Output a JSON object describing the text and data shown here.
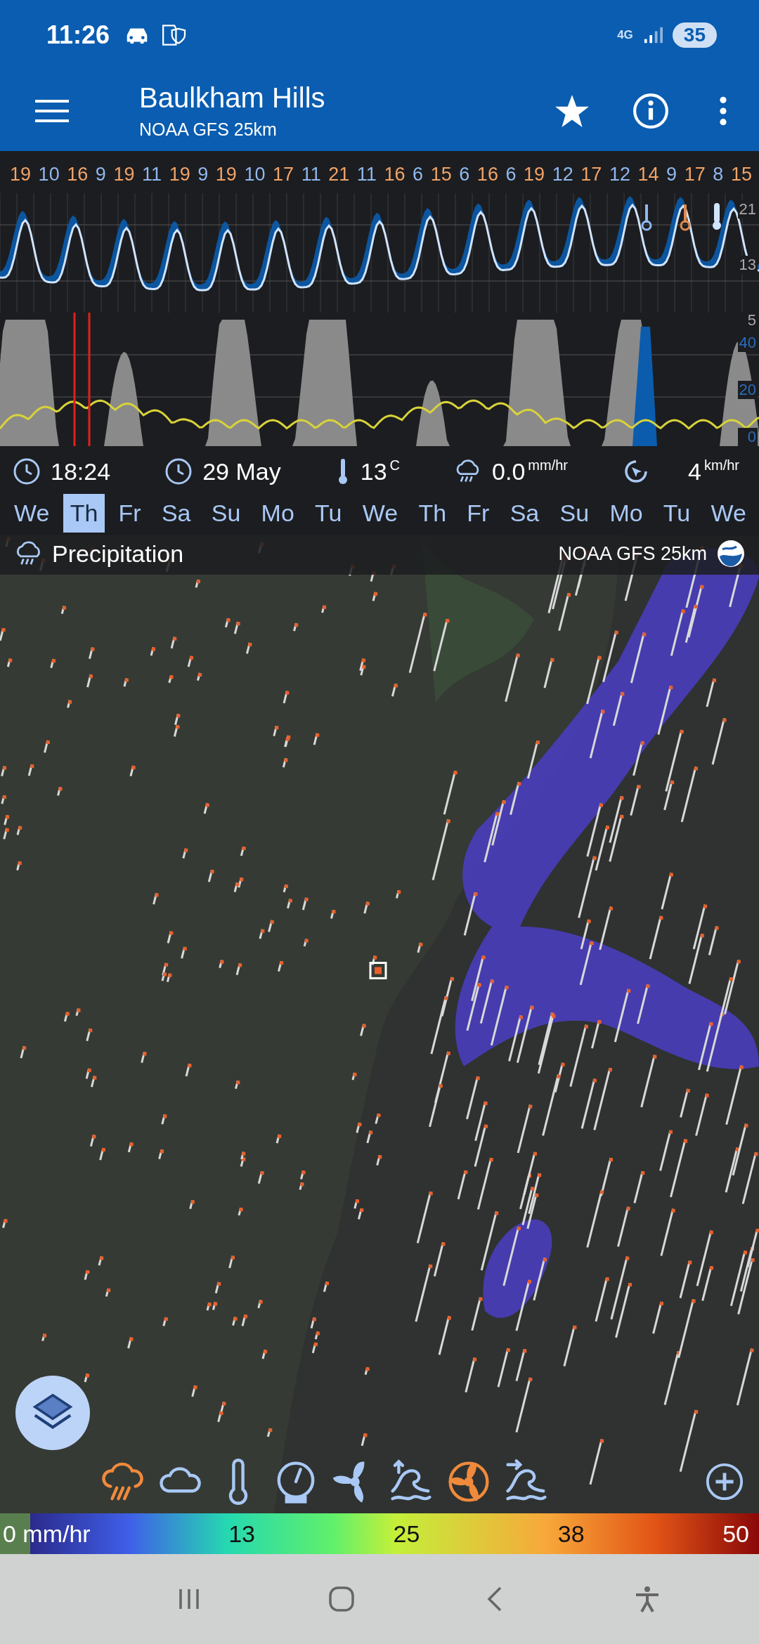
{
  "status_bar": {
    "time": "11:26",
    "network": "4G",
    "battery": "35"
  },
  "app_bar": {
    "title": "Baulkham Hills",
    "subtitle": "NOAA GFS 25km"
  },
  "forecast": {
    "daily_temps": [
      {
        "value": "19",
        "kind": "high"
      },
      {
        "value": "10",
        "kind": "low"
      },
      {
        "value": "16",
        "kind": "high"
      },
      {
        "value": "9",
        "kind": "low"
      },
      {
        "value": "19",
        "kind": "high"
      },
      {
        "value": "11",
        "kind": "low"
      },
      {
        "value": "19",
        "kind": "high"
      },
      {
        "value": "9",
        "kind": "low"
      },
      {
        "value": "19",
        "kind": "high"
      },
      {
        "value": "10",
        "kind": "low"
      },
      {
        "value": "17",
        "kind": "high"
      },
      {
        "value": "11",
        "kind": "low"
      },
      {
        "value": "21",
        "kind": "high"
      },
      {
        "value": "11",
        "kind": "low"
      },
      {
        "value": "16",
        "kind": "high"
      },
      {
        "value": "6",
        "kind": "low"
      },
      {
        "value": "15",
        "kind": "high"
      },
      {
        "value": "6",
        "kind": "low"
      },
      {
        "value": "16",
        "kind": "high"
      },
      {
        "value": "6",
        "kind": "low"
      },
      {
        "value": "19",
        "kind": "high"
      },
      {
        "value": "12",
        "kind": "low"
      },
      {
        "value": "17",
        "kind": "high"
      },
      {
        "value": "12",
        "kind": "low"
      },
      {
        "value": "14",
        "kind": "high"
      },
      {
        "value": "9",
        "kind": "low"
      },
      {
        "value": "17",
        "kind": "high"
      },
      {
        "value": "8",
        "kind": "low"
      },
      {
        "value": "15",
        "kind": "high"
      }
    ],
    "temp_axis": [
      "21",
      "13",
      "5"
    ],
    "rain_axis": [
      "40",
      "20",
      "0"
    ]
  },
  "readout": {
    "time": "18:24",
    "date": "29 May",
    "temperature": "13",
    "temperature_unit": "C",
    "precipitation": "0.0",
    "precipitation_unit": "mm/hr",
    "wind": "4",
    "wind_unit": "km/hr"
  },
  "days": [
    {
      "label": "We",
      "selected": false
    },
    {
      "label": "Th",
      "selected": true
    },
    {
      "label": "Fr",
      "selected": false
    },
    {
      "label": "Sa",
      "selected": false
    },
    {
      "label": "Su",
      "selected": false
    },
    {
      "label": "Mo",
      "selected": false
    },
    {
      "label": "Tu",
      "selected": false
    },
    {
      "label": "We",
      "selected": false
    },
    {
      "label": "Th",
      "selected": false
    },
    {
      "label": "Fr",
      "selected": false
    },
    {
      "label": "Sa",
      "selected": false
    },
    {
      "label": "Su",
      "selected": false
    },
    {
      "label": "Mo",
      "selected": false
    },
    {
      "label": "Tu",
      "selected": false
    },
    {
      "label": "We",
      "selected": false
    }
  ],
  "layer": {
    "title": "Precipitation",
    "model": "NOAA GFS 25km"
  },
  "layer_toolbar": [
    {
      "kind": "rain",
      "selected": true
    },
    {
      "kind": "cloud",
      "selected": false
    },
    {
      "kind": "thermometer",
      "selected": false
    },
    {
      "kind": "gauge",
      "selected": false
    },
    {
      "kind": "propeller",
      "selected": false
    },
    {
      "kind": "wave-up",
      "selected": false
    },
    {
      "kind": "propeller-ring",
      "selected": true
    },
    {
      "kind": "wave-right",
      "selected": false
    }
  ],
  "legend": {
    "labels": [
      "0 mm/hr",
      "13",
      "25",
      "38",
      "50"
    ]
  }
}
